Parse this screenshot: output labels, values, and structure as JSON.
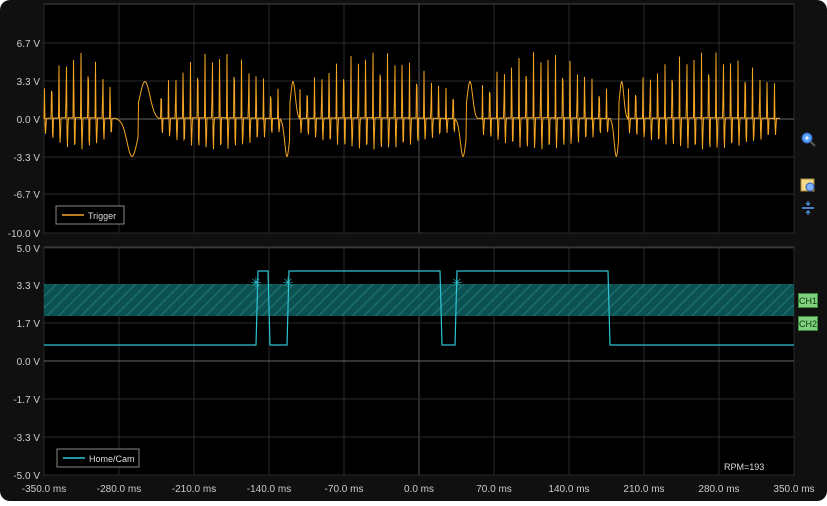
{
  "top_panel": {
    "y_ticks": [
      "6.7 V",
      "3.3 V",
      "0.0 V",
      "-3.3 V",
      "-6.7 V",
      "-10.0 V"
    ],
    "legend": "Trigger",
    "color": "#f5a623"
  },
  "bottom_panel": {
    "y_ticks": [
      "5.0 V",
      "3.3 V",
      "1.7 V",
      "0.0 V",
      "-1.7 V",
      "-3.3 V",
      "-5.0 V"
    ],
    "legend": "Home/Cam",
    "color": "#2ec4d4",
    "rpm": "RPM=193"
  },
  "x_ticks": [
    "-350.0 ms",
    "-280.0 ms",
    "-210.0 ms",
    "-140.0 ms",
    "-70.0 ms",
    "0.0 ms",
    "70.0 ms",
    "140.0 ms",
    "210.0 ms",
    "280.0 ms",
    "350.0 ms"
  ],
  "channels": [
    "CH1",
    "CH2"
  ],
  "icons": [
    "zoom-in-icon",
    "zoom-camera-icon",
    "split-view-icon"
  ]
}
